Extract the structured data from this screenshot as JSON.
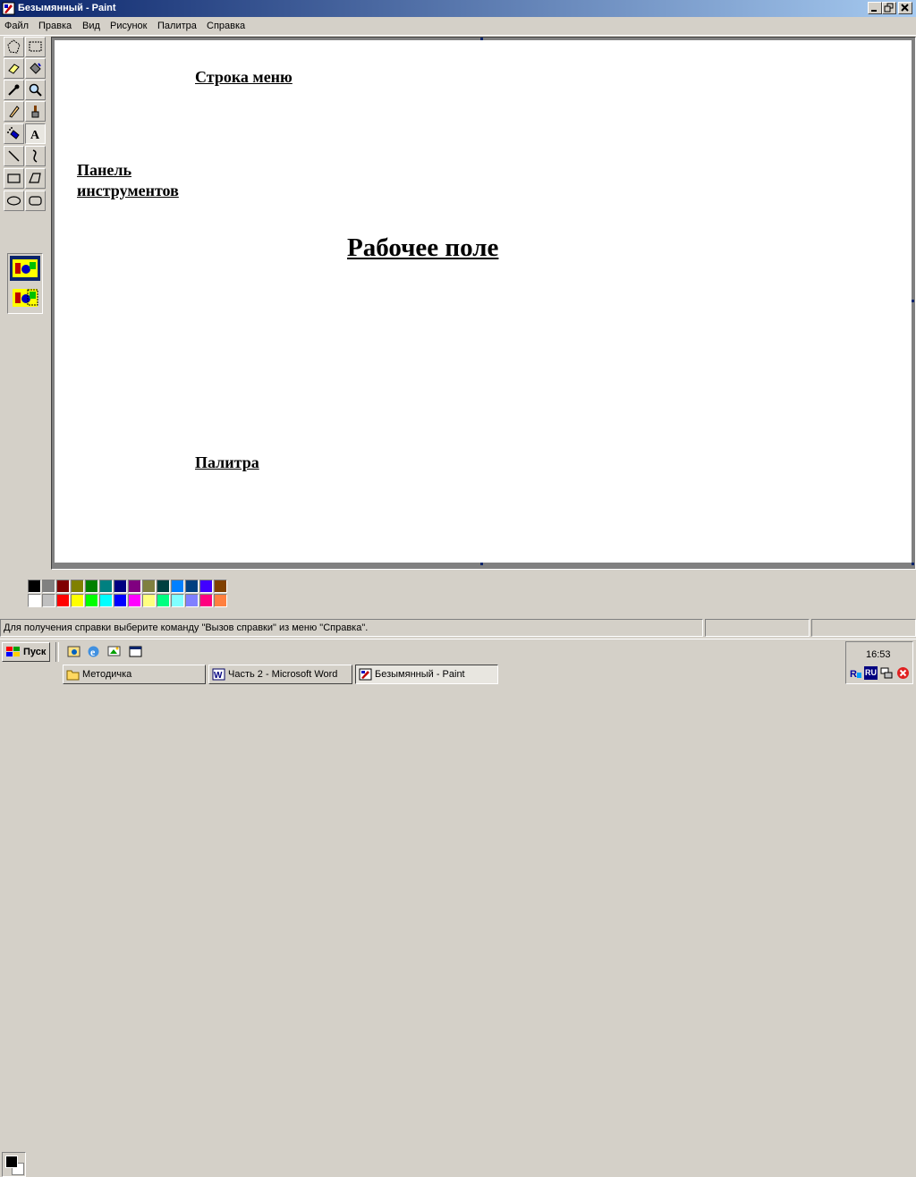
{
  "window": {
    "title": "Безымянный - Paint"
  },
  "menu": [
    "Файл",
    "Правка",
    "Вид",
    "Рисунок",
    "Палитра",
    "Справка"
  ],
  "tools": [
    "free-select",
    "rect-select",
    "eraser",
    "fill",
    "color-picker",
    "magnifier",
    "pencil",
    "brush",
    "airbrush",
    "text",
    "line",
    "curve",
    "rectangle",
    "polygon",
    "ellipse",
    "rounded-rectangle"
  ],
  "annotations": {
    "menu_bar": "Строка меню",
    "toolbox_line1": "Панель",
    "toolbox_line2": "инструментов",
    "canvas": "Рабочее поле",
    "palette": "Палитра"
  },
  "palette": {
    "foreground": "#000000",
    "background": "#ffffff",
    "row1": [
      "#000000",
      "#808080",
      "#800000",
      "#808000",
      "#008000",
      "#008080",
      "#000080",
      "#800080",
      "#808040",
      "#004040",
      "#0080ff",
      "#004080",
      "#4000ff",
      "#804000"
    ],
    "row2": [
      "#ffffff",
      "#c0c0c0",
      "#ff0000",
      "#ffff00",
      "#00ff00",
      "#00ffff",
      "#0000ff",
      "#ff00ff",
      "#ffff80",
      "#00ff80",
      "#80ffff",
      "#8080ff",
      "#ff0080",
      "#ff8040"
    ]
  },
  "status": {
    "text": "Для получения справки выберите команду \"Вызов справки\" из меню \"Справка\"."
  },
  "taskbar": {
    "start": "Пуск",
    "tasks": [
      "Методичка",
      "Часть 2 - Microsoft Word",
      "Безымянный - Paint"
    ],
    "clock": "16:53",
    "lang": "RU"
  }
}
